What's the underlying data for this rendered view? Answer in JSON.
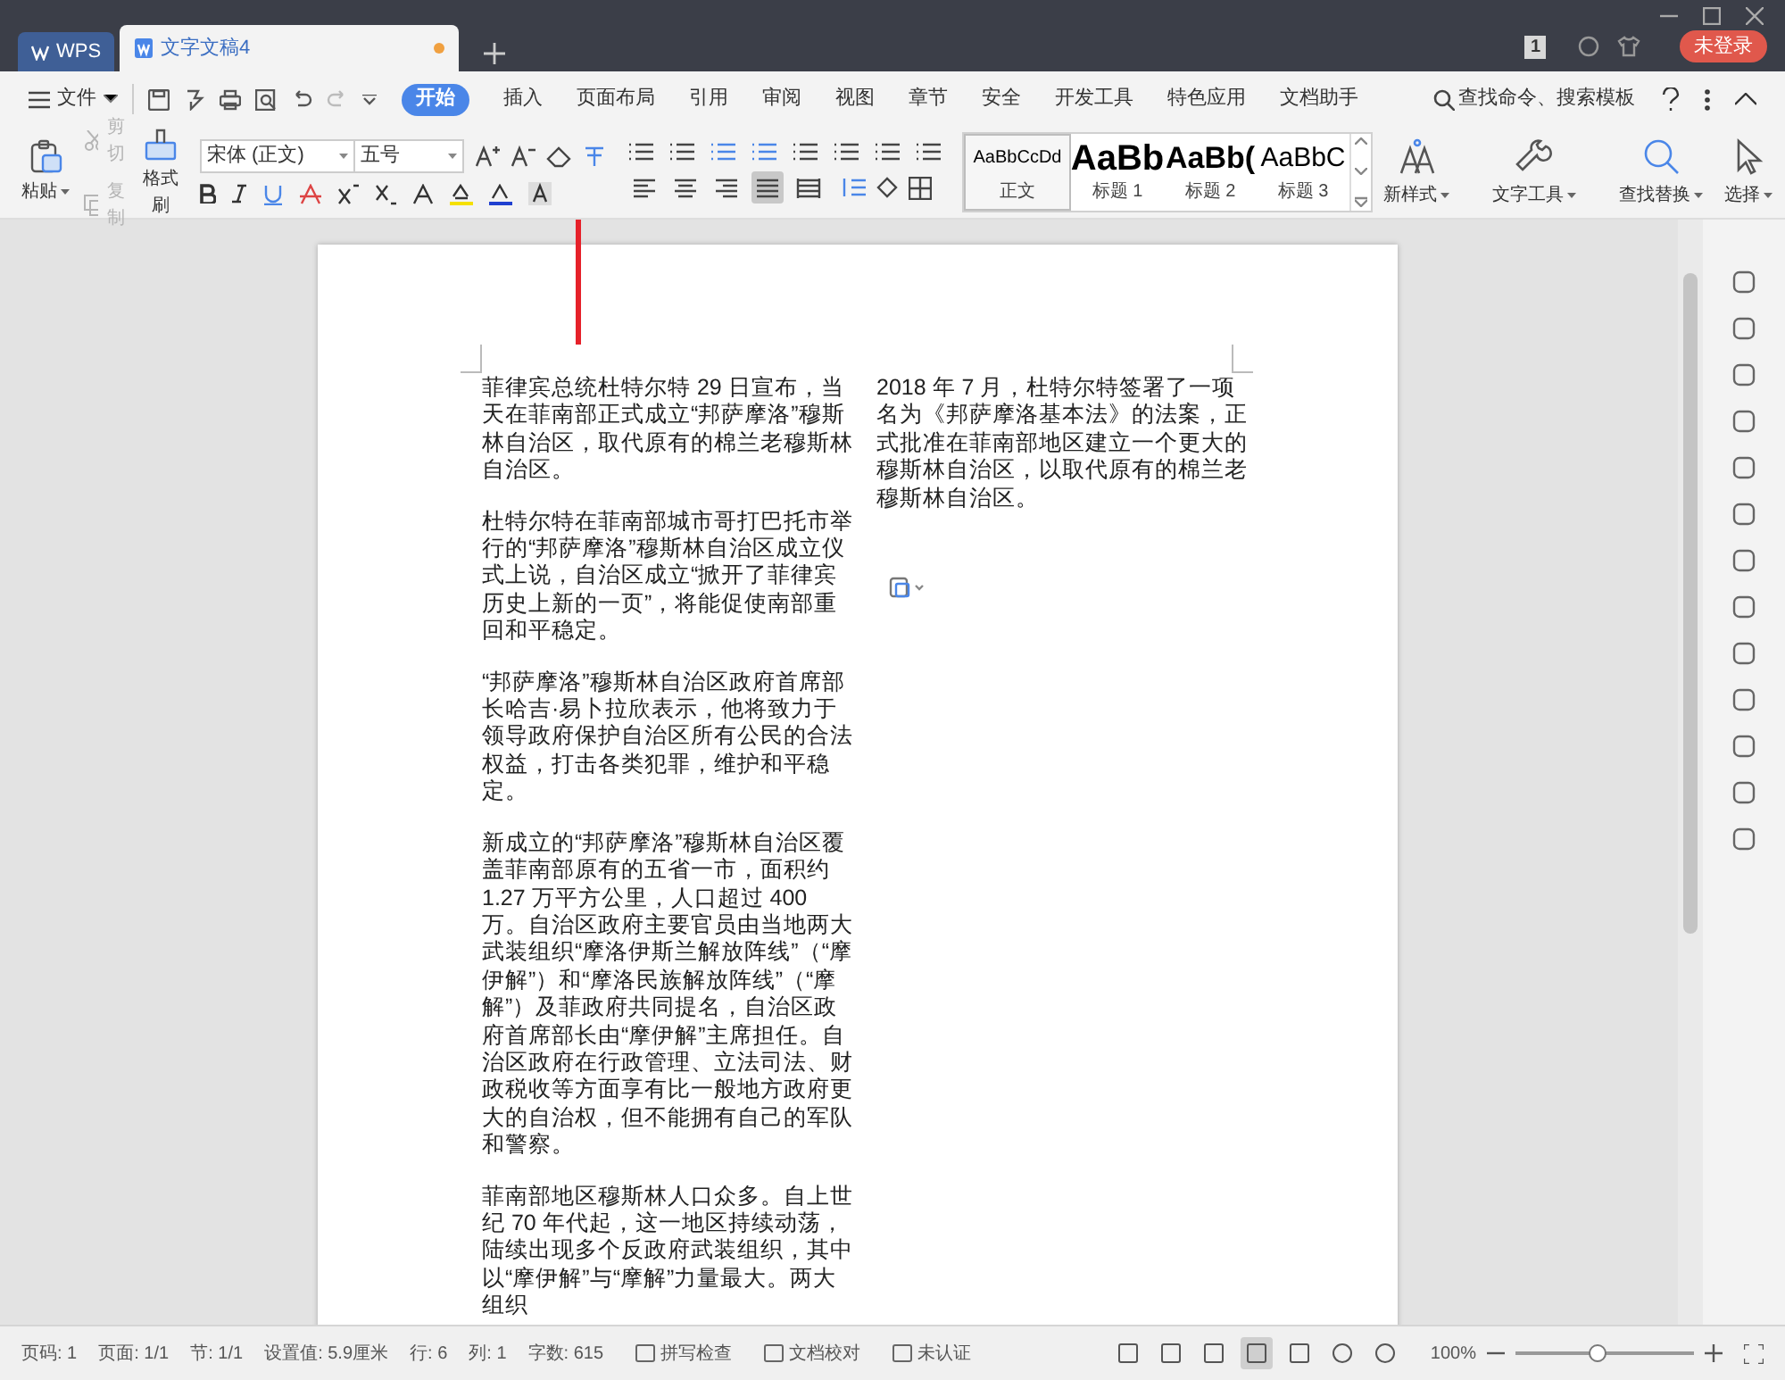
{
  "title_bar": {
    "app_tab": "WPS",
    "doc_tab": {
      "title": "文字文稿4",
      "modified": true
    },
    "page_badge": "1",
    "login_button": "未登录"
  },
  "menu_bar": {
    "file_menu": "文件",
    "tabs": [
      {
        "label": "开始",
        "selected": true
      },
      {
        "label": "插入",
        "selected": false
      },
      {
        "label": "页面布局",
        "selected": false
      },
      {
        "label": "引用",
        "selected": false
      },
      {
        "label": "审阅",
        "selected": false
      },
      {
        "label": "视图",
        "selected": false
      },
      {
        "label": "章节",
        "selected": false
      },
      {
        "label": "安全",
        "selected": false
      },
      {
        "label": "开发工具",
        "selected": false
      },
      {
        "label": "特色应用",
        "selected": false
      },
      {
        "label": "文档助手",
        "selected": false
      }
    ],
    "search": {
      "placeholder": "查找命令、搜索模板"
    }
  },
  "ribbon": {
    "paste": "粘贴",
    "cut": {
      "label": "剪切",
      "disabled": true
    },
    "copy": {
      "label": "复制",
      "disabled": true
    },
    "format_painter": "格式刷",
    "font_name": "宋体 (正文)",
    "font_size": "五号",
    "align_buttons": [
      {
        "kind": "left",
        "selected": false
      },
      {
        "kind": "center",
        "selected": false
      },
      {
        "kind": "right",
        "selected": false
      },
      {
        "kind": "justify",
        "selected": true
      },
      {
        "kind": "distributed",
        "selected": false
      }
    ],
    "styles": [
      {
        "sample": "AaBbCcDd",
        "label": "正文",
        "selected": true,
        "kind": "body"
      },
      {
        "sample": "AaBb",
        "label": "标题 1",
        "selected": false,
        "kind": "h1"
      },
      {
        "sample": "AaBb(",
        "label": "标题 2",
        "selected": false,
        "kind": "h2"
      },
      {
        "sample": "AaBbC",
        "label": "标题 3",
        "selected": false,
        "kind": "h3"
      }
    ],
    "new_style": "新样式",
    "text_tools": "文字工具",
    "find_replace": "查找替换",
    "select": "选择"
  },
  "document": {
    "columns": [
      {
        "paragraphs": [
          "菲律宾总统杜特尔特 29 日宣布，当天在菲南部正式成立“邦萨摩洛”穆斯林自治区，取代原有的棉兰老穆斯林自治区。",
          "杜特尔特在菲南部城市哥打巴托市举行的“邦萨摩洛”穆斯林自治区成立仪式上说，自治区成立“掀开了菲律宾历史上新的一页”，将能促使南部重回和平稳定。",
          "“邦萨摩洛”穆斯林自治区政府首席部长哈吉·易卜拉欣表示，他将致力于领导政府保护自治区所有公民的合法权益，打击各类犯罪，维护和平稳定。",
          "新成立的“邦萨摩洛”穆斯林自治区覆盖菲南部原有的五省一市，面积约 1.27 万平方公里，人口超过 400 万。自治区政府主要官员由当地两大武装组织“摩洛伊斯兰解放阵线”（“摩伊解”）和“摩洛民族解放阵线”（“摩解”）及菲政府共同提名，自治区政府首席部长由“摩伊解”主席担任。自治区政府在行政管理、立法司法、财政税收等方面享有比一般地方政府更大的自治权，但不能拥有自己的军队和警察。",
          "菲南部地区穆斯林人口众多。自上世纪 70 年代起，这一地区持续动荡，陆续出现多个反政府武装组织，其中以“摩伊解”与“摩解”力量最大。两大组织"
        ]
      },
      {
        "paragraphs": [
          "2018 年 7 月，杜特尔特签署了一项名为《邦萨摩洛基本法》的法案，正式批准在菲南部地区建立一个更大的穆斯林自治区，以取代原有的棉兰老穆斯林自治区。"
        ]
      }
    ]
  },
  "status_bar": {
    "items": [
      "页码: 1",
      "页面: 1/1",
      "节: 1/1",
      "设置值: 5.9厘米",
      "行: 6",
      "列: 1",
      "字数: 615"
    ],
    "spell_check": "拼写检查",
    "proofread": "文档校对",
    "certification": "未认证",
    "view_modes": [
      {
        "kind": "fullscreen",
        "selected": false
      },
      {
        "kind": "reading",
        "selected": false
      },
      {
        "kind": "writing",
        "selected": false
      },
      {
        "kind": "page",
        "selected": true
      },
      {
        "kind": "outline",
        "selected": false
      },
      {
        "kind": "web",
        "selected": false
      },
      {
        "kind": "eye",
        "selected": false
      }
    ],
    "zoom": {
      "value": "100%",
      "level": 0.45
    }
  }
}
